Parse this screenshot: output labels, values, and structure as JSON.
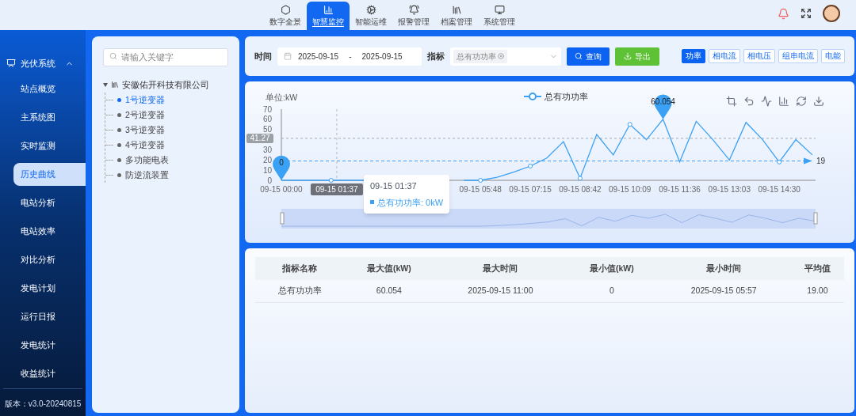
{
  "top_nav": [
    {
      "label": "数字全景",
      "selected": false
    },
    {
      "label": "智慧监控",
      "selected": true
    },
    {
      "label": "智能运维",
      "selected": false
    },
    {
      "label": "报警管理",
      "selected": false
    },
    {
      "label": "档案管理",
      "selected": false
    },
    {
      "label": "系统管理",
      "selected": false
    }
  ],
  "sidebar": {
    "group": {
      "label": "光伏系统",
      "expanded": true
    },
    "items": [
      {
        "label": "站点概览",
        "selected": false
      },
      {
        "label": "主系统图",
        "selected": false
      },
      {
        "label": "实时监测",
        "selected": false
      },
      {
        "label": "历史曲线",
        "selected": true
      },
      {
        "label": "电站分析",
        "selected": false
      },
      {
        "label": "电站效率",
        "selected": false
      },
      {
        "label": "对比分析",
        "selected": false
      },
      {
        "label": "发电计划",
        "selected": false
      },
      {
        "label": "运行日报",
        "selected": false
      },
      {
        "label": "发电统计",
        "selected": false
      },
      {
        "label": "收益统计",
        "selected": false
      }
    ],
    "version": "版本：v3.0-20240815"
  },
  "tree": {
    "search": {
      "placeholder": "请输入关键字"
    },
    "root": {
      "label": "安徽佑开科技有限公司",
      "expanded": true,
      "children": [
        {
          "label": "1号逆变器",
          "selected": true
        },
        {
          "label": "2号逆变器",
          "selected": false
        },
        {
          "label": "3号逆变器",
          "selected": false
        },
        {
          "label": "4号逆变器",
          "selected": false
        },
        {
          "label": "多功能电表",
          "selected": false
        },
        {
          "label": "防逆流装置",
          "selected": false
        }
      ]
    }
  },
  "filter": {
    "time_label": "时间",
    "start": "2025-09-15",
    "separator": "-",
    "end": "2025-09-15",
    "metric_label": "指标",
    "metric_tag": "总有功功率",
    "query": "查询",
    "export": "导出",
    "types": [
      {
        "label": "功率",
        "selected": true
      },
      {
        "label": "相电流",
        "selected": false
      },
      {
        "label": "相电压",
        "selected": false
      },
      {
        "label": "组串电流",
        "selected": false
      },
      {
        "label": "电能",
        "selected": false
      }
    ]
  },
  "chart": {
    "chart_data": {
      "type": "line",
      "ylabel": "单位:kW",
      "categories": [
        "09-15 00:00",
        null,
        null,
        null,
        null,
        null,
        null,
        null,
        null,
        null,
        null,
        null,
        "09-15 05:48",
        null,
        null,
        "09-15 07:15",
        null,
        null,
        "09-15 08:42",
        null,
        null,
        "09-15 10:09",
        null,
        null,
        "09-15 11:36",
        null,
        null,
        "09-15 13:03",
        null,
        null,
        "09-15 14:30",
        null,
        null
      ],
      "series": [
        {
          "name": "总有功功率",
          "color": "#3ba1f5",
          "values": [
            0,
            0,
            0,
            0,
            0,
            0,
            null,
            null,
            null,
            null,
            null,
            0,
            0,
            3,
            8,
            14,
            22,
            38,
            2,
            45,
            25,
            55,
            40,
            60,
            18,
            58,
            40,
            20,
            57,
            40,
            18,
            40,
            25
          ]
        }
      ],
      "ylim": [
        0,
        70
      ],
      "yticks": [
        0,
        10,
        20,
        30,
        50,
        60,
        70
      ],
      "ref_lines": [
        {
          "axis": "y",
          "value": 19,
          "label": "19"
        },
        {
          "axis": "y",
          "value": 41.27,
          "label": "41.27"
        }
      ],
      "annotations": [
        {
          "text": "60.054"
        },
        {
          "text": "0"
        },
        {
          "text": "09-15 01:37"
        }
      ]
    },
    "tooltip": {
      "title": "09-15 01:37",
      "line": "总有功功率: 0kW"
    }
  },
  "table": {
    "columns": [
      "指标名称",
      "最大值(kW)",
      "最大时间",
      "最小值(kW)",
      "最小时间",
      "平均值"
    ],
    "rows": [
      [
        "总有功功率",
        "60.054",
        "2025-09-15 11:00",
        "0",
        "2025-09-15 05:57",
        "19.00"
      ]
    ]
  }
}
